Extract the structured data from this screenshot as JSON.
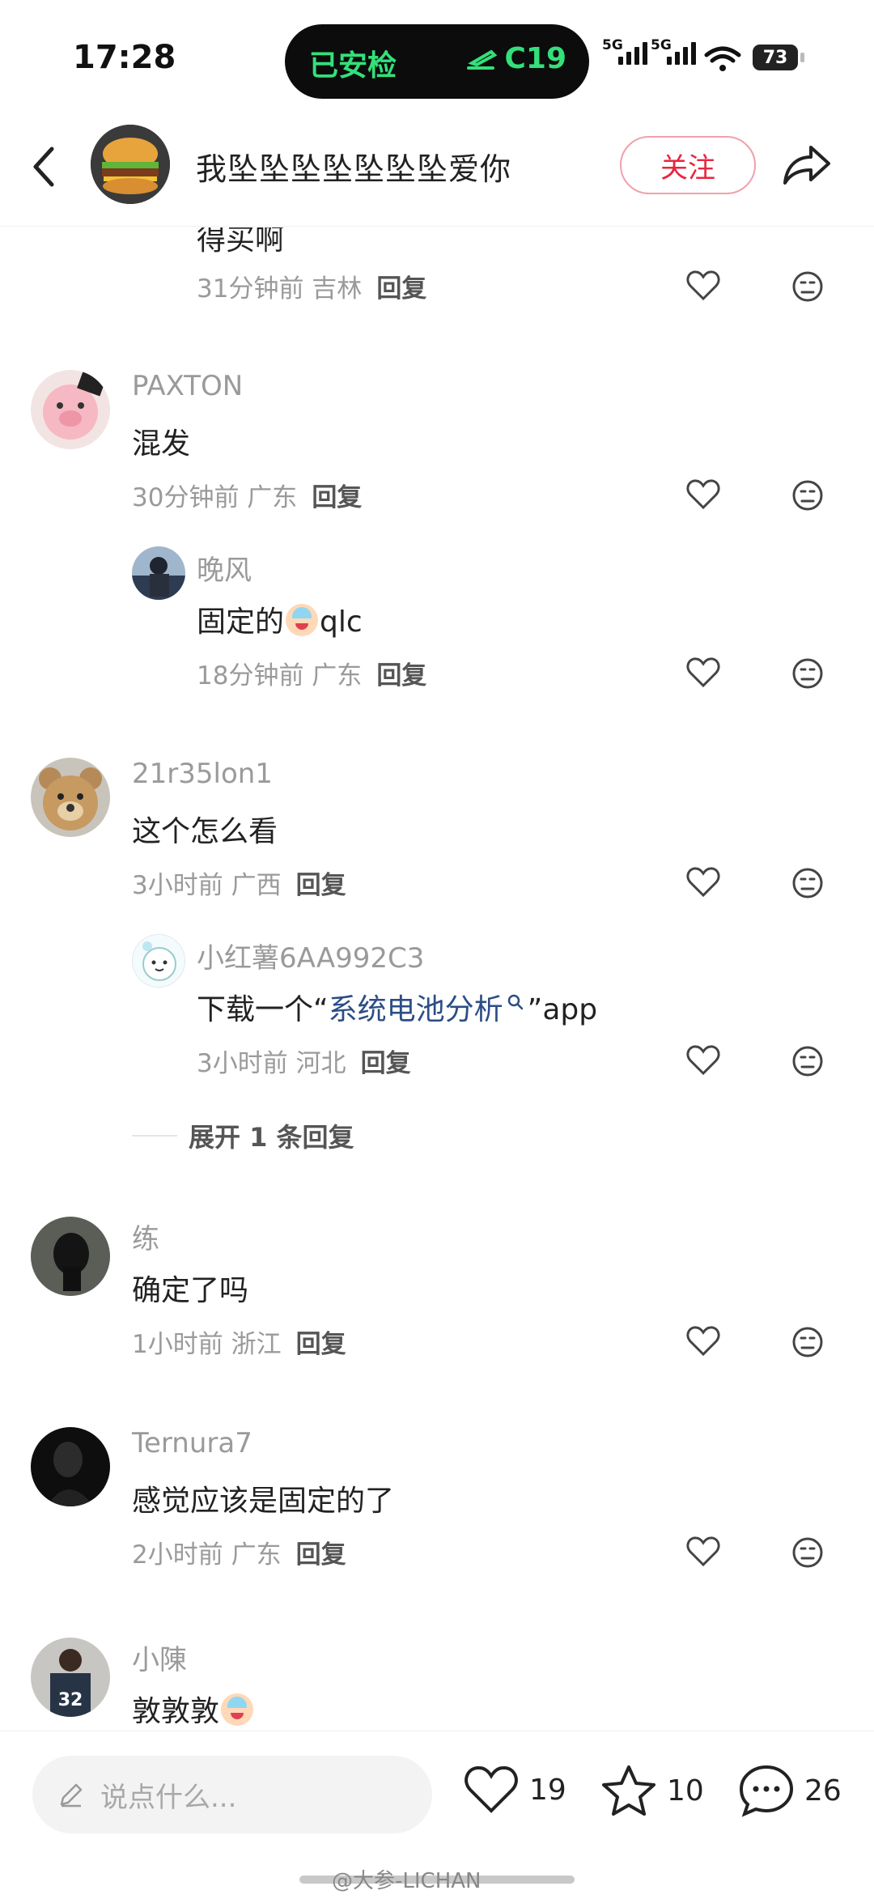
{
  "status": {
    "time": "17:28",
    "island_left": "已安检",
    "island_right": "C19",
    "signal1": "5G",
    "signal2": "5G",
    "battery": "73"
  },
  "header": {
    "title": "我坠坠坠坠坠坠坠爱你",
    "follow": "关注"
  },
  "comments": {
    "c0": {
      "text": "得买啊",
      "meta": "31分钟前 吉林",
      "reply": "回复"
    },
    "c1": {
      "name": "PAXTON",
      "text": "混发",
      "meta": "30分钟前 广东",
      "reply": "回复"
    },
    "c1r": {
      "name": "晚风",
      "text_a": "固定的",
      "text_b": "qlc",
      "meta": "18分钟前 广东",
      "reply": "回复"
    },
    "c2": {
      "name": "21r35lon1",
      "text": "这个怎么看",
      "meta": "3小时前 广西",
      "reply": "回复"
    },
    "c2r": {
      "name": "小红薯6AA992C3",
      "text_a": "下载一个“",
      "link": "系统电池分析",
      "text_b": "”app",
      "meta": "3小时前 河北",
      "reply": "回复"
    },
    "c2_expand": "展开 1 条回复",
    "c3": {
      "name": "练",
      "text": "确定了吗",
      "meta": "1小时前 浙江",
      "reply": "回复"
    },
    "c4": {
      "name": "Ternura7",
      "text": "感觉应该是固定的了",
      "meta": "2小时前 广东",
      "reply": "回复"
    },
    "c5": {
      "name": "小陳",
      "text": "敦敦敦"
    }
  },
  "bottom": {
    "placeholder": "说点什么...",
    "likes": "19",
    "stars": "10",
    "comments": "26",
    "watermark": "@大参-LICHAN"
  },
  "colors": {
    "accent": "#e8263f",
    "link": "#2c4d85",
    "island_text": "#33e07a"
  },
  "icons": [
    "back-icon",
    "share-icon",
    "heart-icon",
    "dislike-face-icon",
    "pencil-icon",
    "star-icon",
    "comment-bubble-icon",
    "wifi-icon",
    "plane-icon"
  ]
}
